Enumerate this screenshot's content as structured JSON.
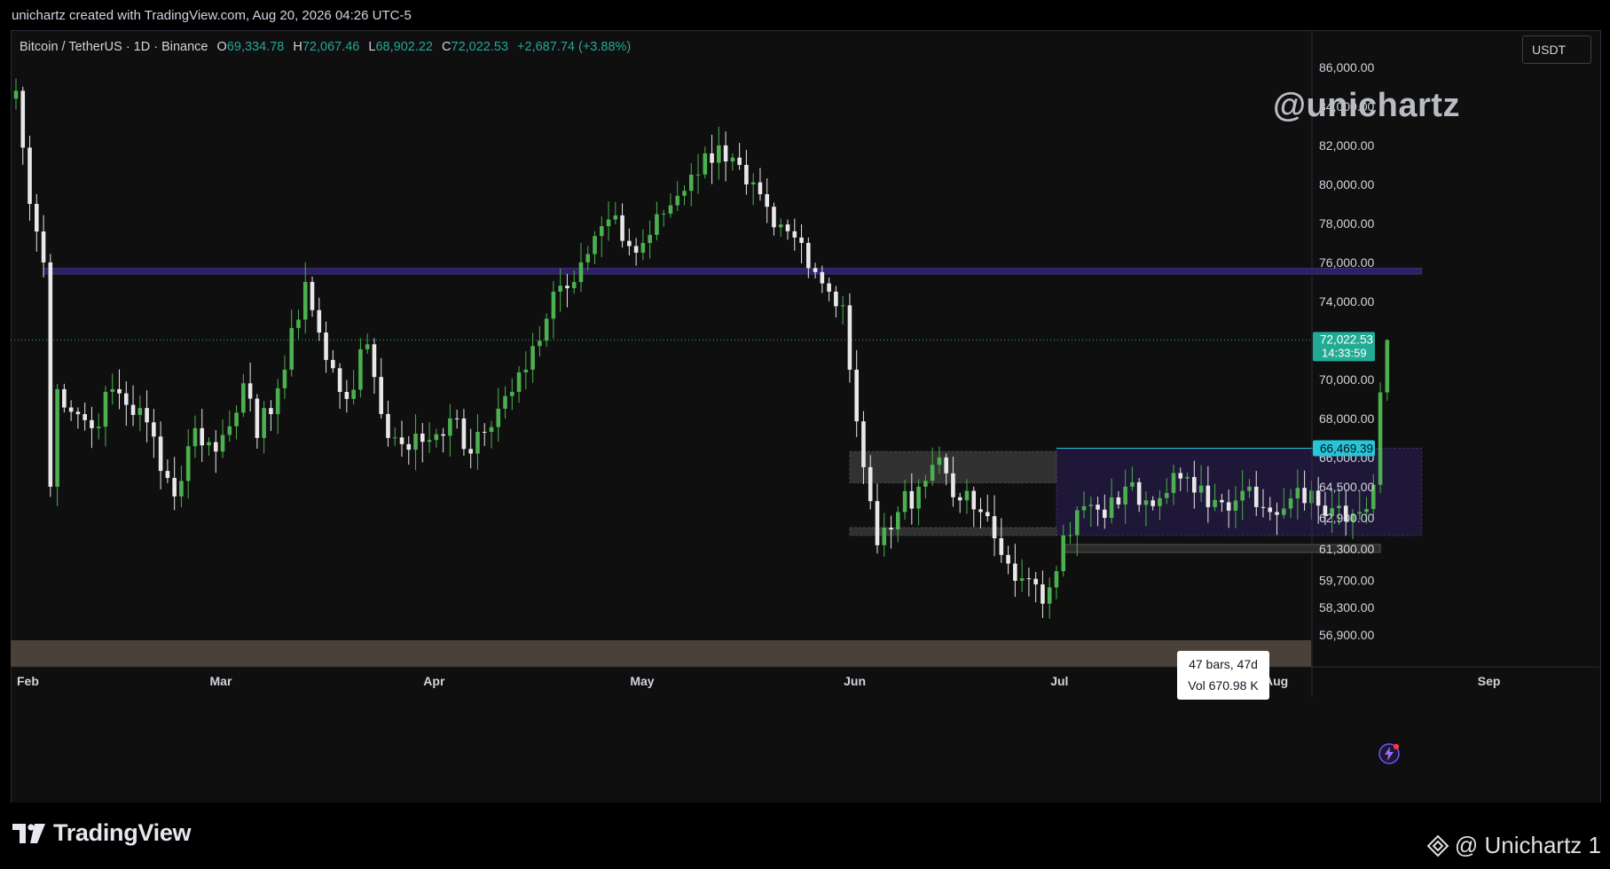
{
  "header": {
    "created_by": "unichartz created with TradingView.com, Aug 20, 2026 04:26 UTC-5"
  },
  "legend": {
    "symbol": "Bitcoin / TetherUS · 1D · Binance",
    "open_label": "O",
    "open": "69,334.78",
    "high_label": "H",
    "high": "72,067.46",
    "low_label": "L",
    "low": "68,902.22",
    "close_label": "C",
    "close": "72,022.53",
    "change": "+2,687.74 (+3.88%)"
  },
  "watermark": "@unichartz",
  "currency_button": "USDT",
  "price_tags": {
    "last_price": "72,022.53",
    "countdown": "14:33:59",
    "level": "66,469.39"
  },
  "measure_box": {
    "bars": "47 bars, 47d",
    "volume": "Vol 670.98 K"
  },
  "footer": {
    "logo_text": "TradingView",
    "credit": "@ Unichartz 1"
  },
  "colors": {
    "up": "#4caf50",
    "down": "#e8e8e8",
    "background": "#0f0f0f",
    "zone_purple": "#2a1f52",
    "level_line": "#26c6da",
    "last_price": "#22ab94"
  },
  "icons": {
    "logo": "tradingview-logo-icon",
    "binance": "binance-diamond-icon",
    "alert": "lightning-alert-icon"
  },
  "chart_data": {
    "type": "candlestick",
    "x_ticks": [
      "Feb",
      "Mar",
      "Apr",
      "May",
      "Jun",
      "Jul",
      "Aug",
      "Sep"
    ],
    "y_ticks": [
      86000,
      84000,
      82000,
      80000,
      78000,
      76000,
      74000,
      70000,
      68000,
      66000,
      64500,
      62900,
      61300,
      59700,
      58300,
      56900
    ],
    "y_tick_labels": [
      "86,000.00",
      "84,000.00",
      "82,000.00",
      "80,000.00",
      "78,000.00",
      "76,000.00",
      "74,000.00",
      "70,000.00",
      "68,000.00",
      "66,000.00",
      "64,500.00",
      "62,900.00",
      "61,300.00",
      "59,700.00",
      "58,300.00",
      "56,900.00"
    ],
    "anchor_points": [
      [
        "2026-02-01",
        84800
      ],
      [
        "2026-02-03",
        79000
      ],
      [
        "2026-02-05",
        76000
      ],
      [
        "2026-02-06",
        64500
      ],
      [
        "2026-02-07",
        69500
      ],
      [
        "2026-02-12",
        67500
      ],
      [
        "2026-02-15",
        69500
      ],
      [
        "2026-02-20",
        67800
      ],
      [
        "2026-02-24",
        64000
      ],
      [
        "2026-02-27",
        67500
      ],
      [
        "2026-03-02",
        66300
      ],
      [
        "2026-03-06",
        69800
      ],
      [
        "2026-03-08",
        67000
      ],
      [
        "2026-03-12",
        70500
      ],
      [
        "2026-03-15",
        75000
      ],
      [
        "2026-03-18",
        71000
      ],
      [
        "2026-03-21",
        69000
      ],
      [
        "2026-03-24",
        71800
      ],
      [
        "2026-03-27",
        67000
      ],
      [
        "2026-04-01",
        66800
      ],
      [
        "2026-04-05",
        68000
      ],
      [
        "2026-04-08",
        66200
      ],
      [
        "2026-04-12",
        68500
      ],
      [
        "2026-04-16",
        70500
      ],
      [
        "2026-04-20",
        74500
      ],
      [
        "2026-04-24",
        76000
      ],
      [
        "2026-04-28",
        78200
      ],
      [
        "2026-05-02",
        76500
      ],
      [
        "2026-05-06",
        78500
      ],
      [
        "2026-05-10",
        80500
      ],
      [
        "2026-05-14",
        82000
      ],
      [
        "2026-05-18",
        80000
      ],
      [
        "2026-05-22",
        77800
      ],
      [
        "2026-05-26",
        77000
      ],
      [
        "2026-05-30",
        74500
      ],
      [
        "2026-06-01",
        73800
      ],
      [
        "2026-06-02",
        70500
      ],
      [
        "2026-06-04",
        65500
      ],
      [
        "2026-06-06",
        61500
      ],
      [
        "2026-06-09",
        63200
      ],
      [
        "2026-06-12",
        64500
      ],
      [
        "2026-06-15",
        66000
      ],
      [
        "2026-06-18",
        63800
      ],
      [
        "2026-06-21",
        63200
      ],
      [
        "2026-06-24",
        61000
      ],
      [
        "2026-06-27",
        59800
      ],
      [
        "2026-06-30",
        58500
      ],
      [
        "2026-07-03",
        62000
      ],
      [
        "2026-07-06",
        63500
      ],
      [
        "2026-07-09",
        62900
      ],
      [
        "2026-07-12",
        64500
      ],
      [
        "2026-07-15",
        63800
      ],
      [
        "2026-07-19",
        65200
      ],
      [
        "2026-07-22",
        64200
      ],
      [
        "2026-07-26",
        63700
      ],
      [
        "2026-07-30",
        64500
      ],
      [
        "2026-08-02",
        63200
      ],
      [
        "2026-08-05",
        63900
      ],
      [
        "2026-08-08",
        64300
      ],
      [
        "2026-08-11",
        63400
      ],
      [
        "2026-08-15",
        63200
      ],
      [
        "2026-08-17",
        64600
      ],
      [
        "2026-08-18",
        69334.78
      ],
      [
        "2026-08-19",
        72022.53
      ]
    ],
    "last_candle": {
      "open": 69334.78,
      "high": 72067.46,
      "low": 68902.22,
      "close": 72022.53
    },
    "zones": [
      {
        "kind": "resistance-band",
        "from": "2026-02-05",
        "to": "2026-08-24",
        "low": 75400,
        "high": 75700
      },
      {
        "kind": "consolidation-range",
        "from": "2026-07-02",
        "to": "2026-08-24",
        "low": 62000,
        "high": 66469.39
      },
      {
        "kind": "grey-box-upper",
        "from": "2026-06-02",
        "to": "2026-07-02",
        "low": 64700,
        "high": 66300
      },
      {
        "kind": "grey-box-lower",
        "from": "2026-06-02",
        "to": "2026-07-02",
        "low": 62000,
        "high": 62400
      }
    ],
    "level_line": 66469.39,
    "last_price_line": 72022.53
  }
}
